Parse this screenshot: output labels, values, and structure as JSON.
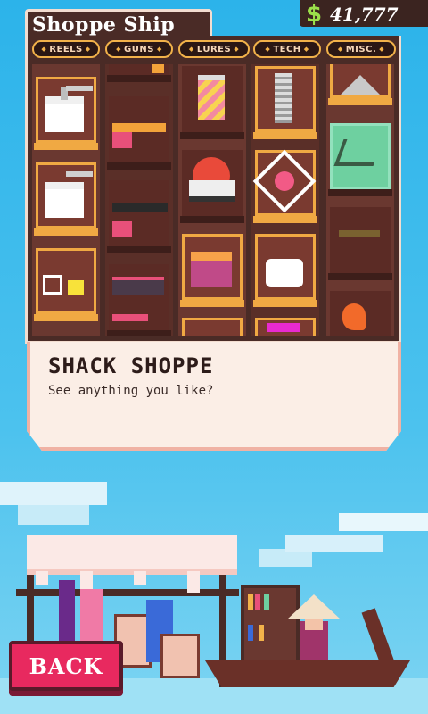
{
  "header": {
    "title": "Shoppe Ship",
    "currency_icon": "$",
    "money": "41,777"
  },
  "tabs": [
    {
      "label": "REELS"
    },
    {
      "label": "GUNS"
    },
    {
      "label": "LURES"
    },
    {
      "label": "TECH"
    },
    {
      "label": "MISC."
    }
  ],
  "dialog": {
    "speaker": "SHACK SHOPPE",
    "line": "See anything you like?"
  },
  "footer": {
    "back_label": "BACK"
  },
  "colors": {
    "panel": "#4a2b26",
    "tab_border": "#f2b24a",
    "money_green": "#9be04a",
    "back_button": "#e8295f",
    "sky": "#2cb3ea"
  },
  "items": {
    "reels": [
      "reel-icon",
      "reel-icon",
      "reel-icon"
    ],
    "guns": [
      "gun-icon",
      "gun-icon",
      "gun-icon",
      "gun-icon"
    ],
    "lures": [
      "lure-can-icon",
      "lure-bomb-icon",
      "lure-robot-icon"
    ],
    "tech": [
      "spring-icon",
      "crosshair-heart-icon",
      "clip-icon"
    ],
    "misc": [
      "rock-icon",
      "fish-skeleton-icon",
      "hat-icon",
      "shrimp-icon"
    ]
  }
}
